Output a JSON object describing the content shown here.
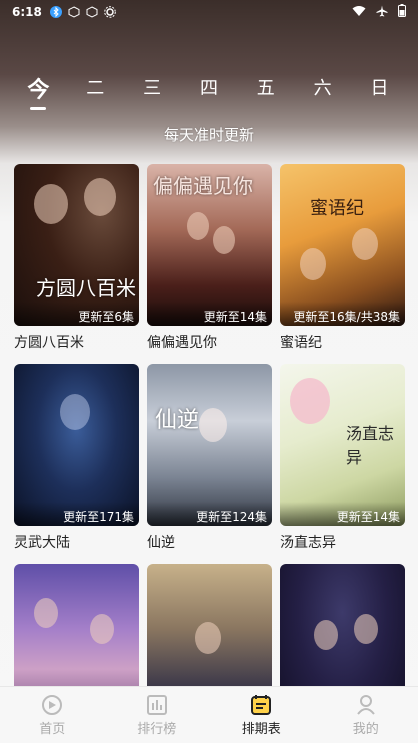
{
  "status_bar": {
    "time": "6:18"
  },
  "day_tabs": [
    {
      "label": "今",
      "active": true
    },
    {
      "label": "二",
      "active": false
    },
    {
      "label": "三",
      "active": false
    },
    {
      "label": "四",
      "active": false
    },
    {
      "label": "五",
      "active": false
    },
    {
      "label": "六",
      "active": false
    },
    {
      "label": "日",
      "active": false
    }
  ],
  "subtitle": "每天准时更新",
  "shows": [
    {
      "title": "方圆八百米",
      "badge": "更新至6集",
      "poster_text": "方圆八百米"
    },
    {
      "title": "偏偏遇见你",
      "badge": "更新至14集",
      "poster_text": "偏偏遇见你"
    },
    {
      "title": "蜜语纪",
      "badge": "更新至16集/共38集",
      "poster_text": "蜜语纪"
    },
    {
      "title": "灵武大陆",
      "badge": "更新至171集",
      "poster_text": ""
    },
    {
      "title": "仙逆",
      "badge": "更新至124集",
      "poster_text": "仙逆"
    },
    {
      "title": "汤直志异",
      "badge": "更新至14集",
      "poster_text": "汤直志异"
    },
    {
      "title": "",
      "badge": "",
      "poster_text": ""
    },
    {
      "title": "",
      "badge": "",
      "poster_text": ""
    },
    {
      "title": "",
      "badge": "",
      "poster_text": ""
    }
  ],
  "bottom_nav": [
    {
      "label": "首页",
      "icon": "home-icon",
      "active": false
    },
    {
      "label": "排行榜",
      "icon": "ranking-icon",
      "active": false
    },
    {
      "label": "排期表",
      "icon": "schedule-icon",
      "active": true
    },
    {
      "label": "我的",
      "icon": "profile-icon",
      "active": false
    }
  ]
}
